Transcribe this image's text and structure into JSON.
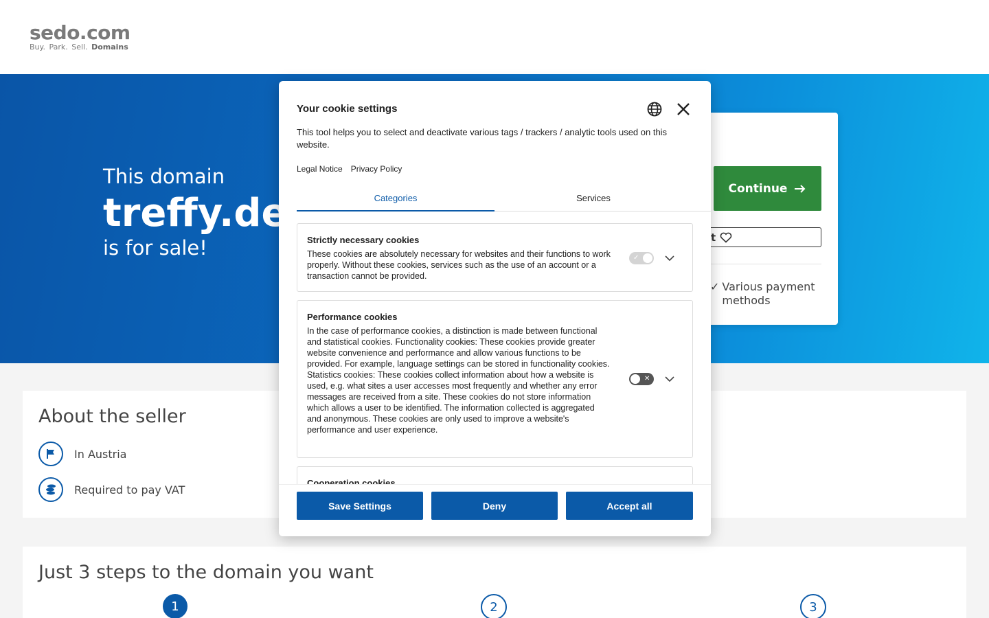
{
  "header": {
    "logo_main": "sedo.com",
    "logo_tag_plain": "Buy.  Park.  Sell.",
    "logo_tag_bold": "Domains"
  },
  "hero": {
    "line1": "This domain",
    "domain": "treffy.de",
    "line3": "is for sale!"
  },
  "sale_card": {
    "continue_label": "Continue",
    "watch_label": "t",
    "payment_text": "Various payment methods"
  },
  "about": {
    "title": "About the seller",
    "location": "In Austria",
    "vat": "Required to pay VAT"
  },
  "steps": {
    "title": "Just 3 steps to the domain you want",
    "numbers": [
      "1",
      "2",
      "3"
    ]
  },
  "cookie_modal": {
    "title": "Your cookie settings",
    "description": "This tool helps you to select and deactivate various tags / trackers / analytic tools used on this website.",
    "links": [
      "Legal Notice",
      "Privacy Policy"
    ],
    "tabs": [
      "Categories",
      "Services"
    ],
    "categories": [
      {
        "title": "Strictly necessary cookies",
        "description": "These cookies are absolutely necessary for websites and their functions to work properly. Without these cookies, services such as the use of an account or a transaction cannot be provided.",
        "enabled": true,
        "locked": true
      },
      {
        "title": "Performance cookies",
        "description": "In the case of performance cookies, a distinction is made between functional and statistical cookies. Functionality cookies: These cookies provide greater website convenience and performance and allow various functions to be provided. For example, language settings can be stored in functionality cookies. Statistics cookies: These cookies collect information about how a website is used, e.g. what sites a user accesses most frequently and whether any error messages are received from a site. These cookies do not store information which allows a user to be identified. The information collected is aggregated and anonymous. These cookies are only used to improve a website's performance and user experience.",
        "enabled": false,
        "locked": false
      },
      {
        "title": "Cooperation cookies"
      }
    ],
    "buttons": {
      "save": "Save Settings",
      "deny": "Deny",
      "accept": "Accept all"
    }
  },
  "colors": {
    "brand_blue": "#0b5aa8",
    "continue_green": "#2f8a3c"
  }
}
